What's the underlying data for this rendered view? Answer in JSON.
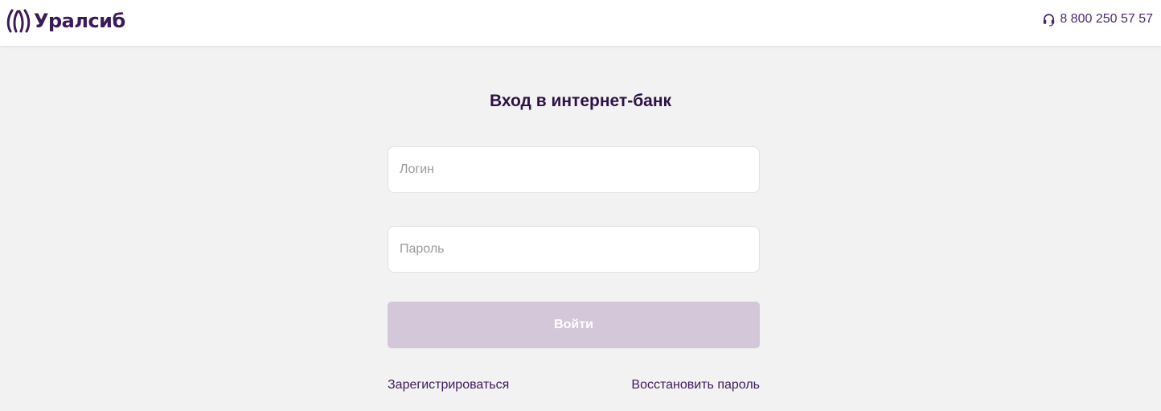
{
  "header": {
    "logo_text": "Уралсиб",
    "phone": "8 800 250 57 57"
  },
  "login_form": {
    "title": "Вход в интернет-банк",
    "login_placeholder": "Логин",
    "password_placeholder": "Пароль",
    "submit_label": "Войти",
    "register_link": "Зарегистрироваться",
    "restore_link": "Восстановить пароль"
  },
  "icons": {
    "logo": "uralsib-logo-icon",
    "phone": "headset-icon"
  },
  "colors": {
    "brand": "#3b1a5a",
    "page_background": "#f3f2f2",
    "button_disabled": "#d3c7d9"
  }
}
